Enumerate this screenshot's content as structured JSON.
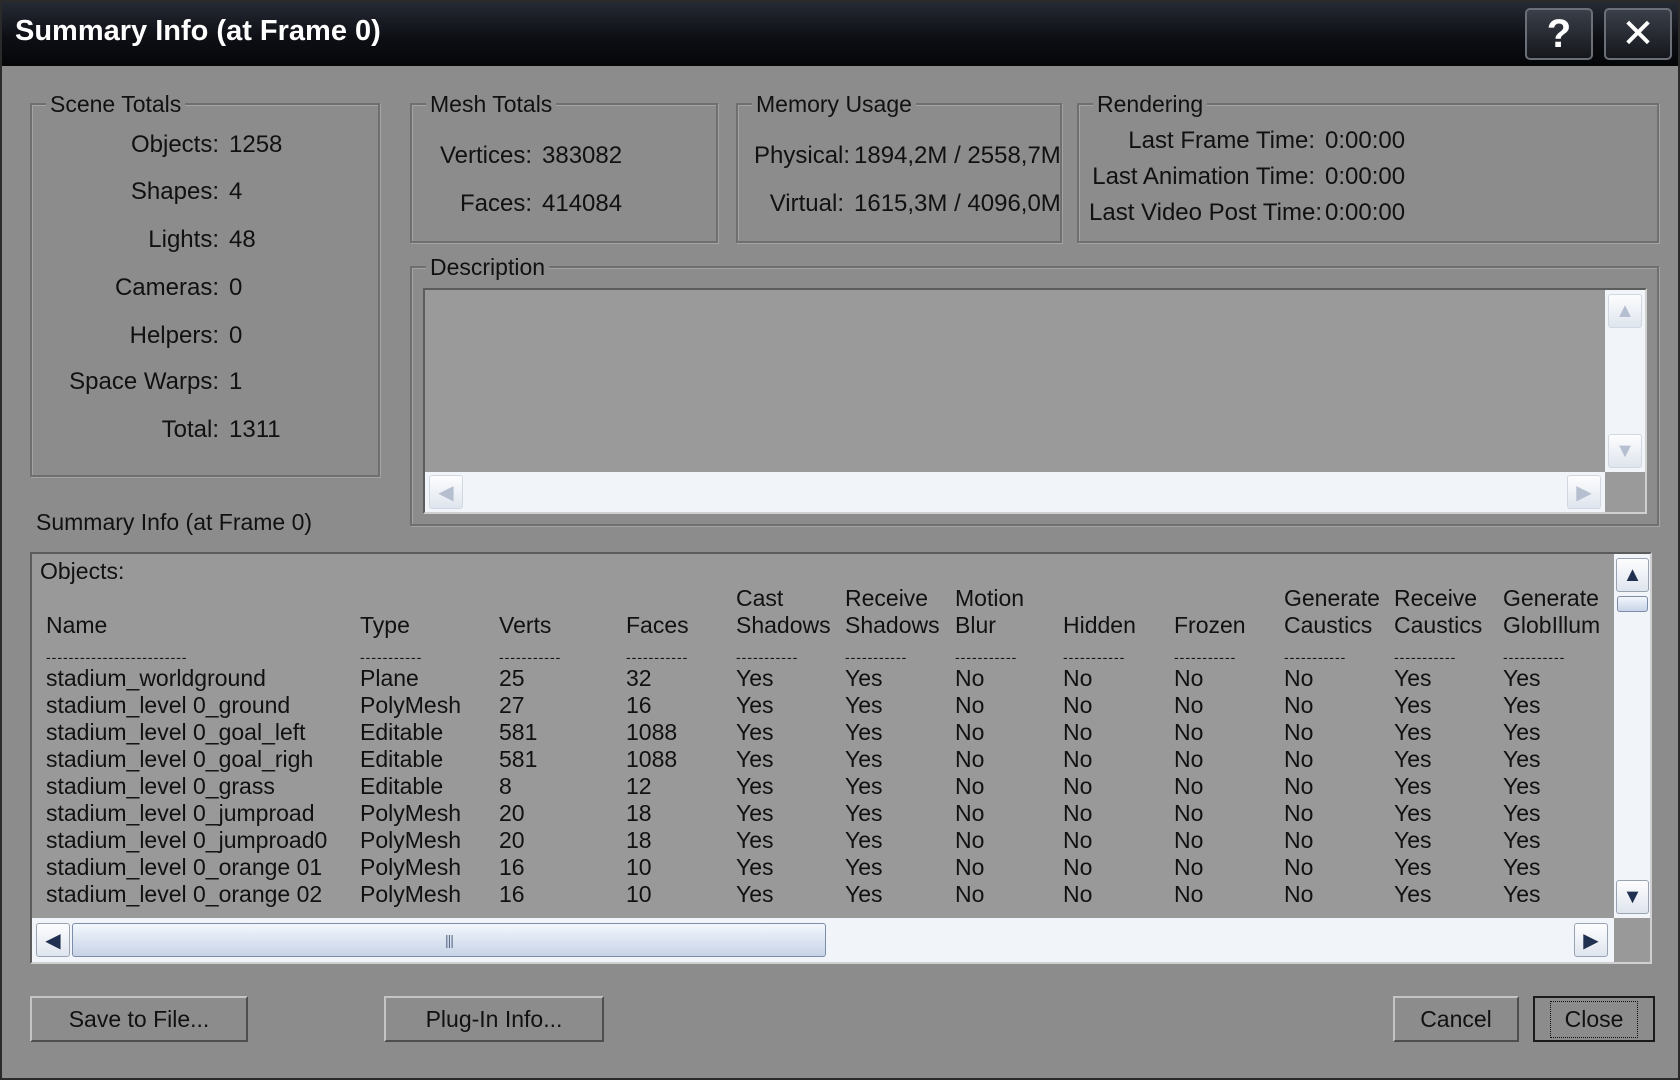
{
  "window": {
    "title": "Summary Info (at Frame 0)",
    "help_label": "?",
    "close_label": "✕"
  },
  "scene_totals": {
    "title": "Scene Totals",
    "rows": [
      {
        "label": "Objects:",
        "value": "1258"
      },
      {
        "label": "Shapes:",
        "value": "4"
      },
      {
        "label": "Lights:",
        "value": "48"
      },
      {
        "label": "Cameras:",
        "value": "0"
      },
      {
        "label": "Helpers:",
        "value": "0"
      },
      {
        "label": "Space Warps:",
        "value": "1"
      },
      {
        "label": "Total:",
        "value": "1311"
      }
    ]
  },
  "mesh_totals": {
    "title": "Mesh Totals",
    "rows": [
      {
        "label": "Vertices:",
        "value": "383082"
      },
      {
        "label": "Faces:",
        "value": "414084"
      }
    ]
  },
  "memory_usage": {
    "title": "Memory Usage",
    "rows": [
      {
        "label": "Physical:",
        "value": "1894,2M / 2558,7M"
      },
      {
        "label": "Virtual:",
        "value": "1615,3M / 4096,0M"
      }
    ]
  },
  "rendering": {
    "title": "Rendering",
    "rows": [
      {
        "label": "Last Frame Time:",
        "value": "0:00:00"
      },
      {
        "label": "Last Animation Time:",
        "value": "0:00:00"
      },
      {
        "label": "Last Video Post Time:",
        "value": "0:00:00"
      }
    ]
  },
  "description": {
    "title": "Description",
    "value": ""
  },
  "summary_label": "Summary Info (at Frame 0)",
  "objects_list": {
    "heading": "Objects:",
    "columns": [
      {
        "l1": "",
        "l2": "Name"
      },
      {
        "l1": "",
        "l2": "Type"
      },
      {
        "l1": "",
        "l2": "Verts"
      },
      {
        "l1": "",
        "l2": "Faces"
      },
      {
        "l1": "Cast",
        "l2": "Shadows"
      },
      {
        "l1": "Receive",
        "l2": "Shadows"
      },
      {
        "l1": "Motion",
        "l2": "Blur"
      },
      {
        "l1": "",
        "l2": "Hidden"
      },
      {
        "l1": "",
        "l2": "Frozen"
      },
      {
        "l1": "Generate",
        "l2": "Caustics"
      },
      {
        "l1": "Receive",
        "l2": "Caustics"
      },
      {
        "l1": "Generate",
        "l2": "GlobIllum"
      }
    ],
    "dashes": [
      "-------------------------",
      "-----------",
      "-----------",
      "-----------",
      "-----------",
      "-----------",
      "-----------",
      "-----------",
      "-----------",
      "-----------",
      "-----------",
      "-----------"
    ],
    "rows": [
      [
        "stadium_worldground",
        "Plane",
        "25",
        "32",
        "Yes",
        "Yes",
        "No",
        "No",
        "No",
        "No",
        "Yes",
        "Yes"
      ],
      [
        "stadium_level 0_ground",
        "PolyMesh",
        "27",
        "16",
        "Yes",
        "Yes",
        "No",
        "No",
        "No",
        "No",
        "Yes",
        "Yes"
      ],
      [
        "stadium_level 0_goal_left",
        "Editable",
        "581",
        "1088",
        "Yes",
        "Yes",
        "No",
        "No",
        "No",
        "No",
        "Yes",
        "Yes"
      ],
      [
        "stadium_level 0_goal_righ",
        "Editable",
        "581",
        "1088",
        "Yes",
        "Yes",
        "No",
        "No",
        "No",
        "No",
        "Yes",
        "Yes"
      ],
      [
        "stadium_level 0_grass",
        "Editable",
        "8",
        "12",
        "Yes",
        "Yes",
        "No",
        "No",
        "No",
        "No",
        "Yes",
        "Yes"
      ],
      [
        "stadium_level 0_jumproad",
        "PolyMesh",
        "20",
        "18",
        "Yes",
        "Yes",
        "No",
        "No",
        "No",
        "No",
        "Yes",
        "Yes"
      ],
      [
        "stadium_level 0_jumproad0",
        "PolyMesh",
        "20",
        "18",
        "Yes",
        "Yes",
        "No",
        "No",
        "No",
        "No",
        "Yes",
        "Yes"
      ],
      [
        "stadium_level 0_orange 01",
        "PolyMesh",
        "16",
        "10",
        "Yes",
        "Yes",
        "No",
        "No",
        "No",
        "No",
        "Yes",
        "Yes"
      ],
      [
        "stadium_level 0_orange 02",
        "PolyMesh",
        "16",
        "10",
        "Yes",
        "Yes",
        "No",
        "No",
        "No",
        "No",
        "Yes",
        "Yes"
      ]
    ]
  },
  "buttons": {
    "save": "Save to File...",
    "plugin": "Plug-In Info...",
    "cancel": "Cancel",
    "close": "Close"
  },
  "icons": {
    "up": "▲",
    "down": "▼",
    "left": "◀",
    "right": "▶",
    "grip": "|||"
  }
}
